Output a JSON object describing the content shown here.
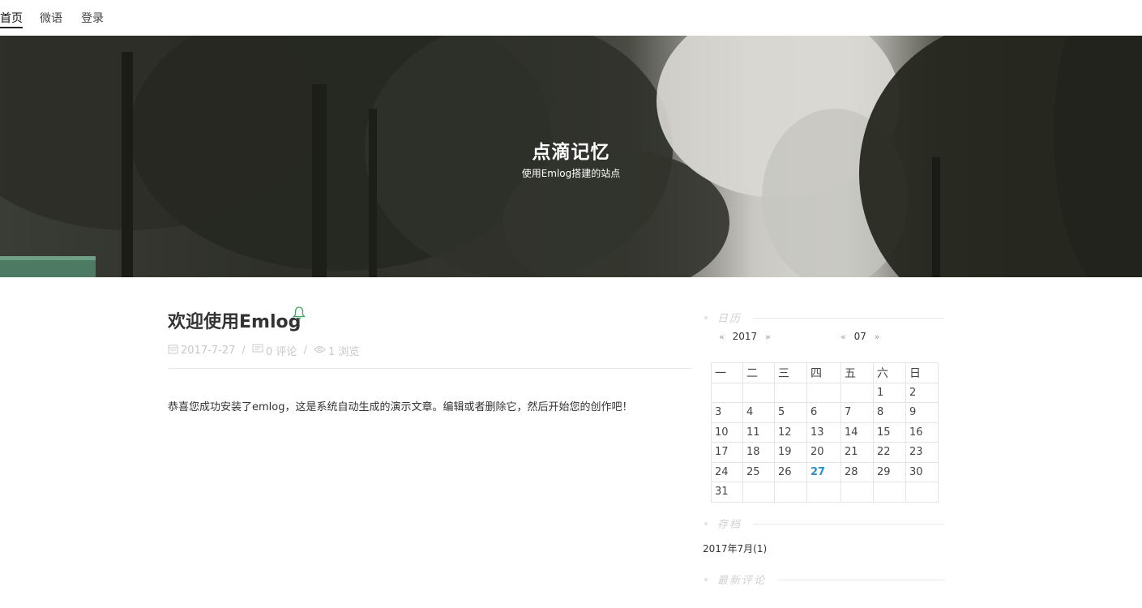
{
  "nav": {
    "home": "首页",
    "micro": "微语",
    "login": "登录"
  },
  "site": {
    "title": "点滴记忆",
    "subtitle": "使用Emlog搭建的站点"
  },
  "post": {
    "title": "欢迎使用Emlog",
    "date": "2017-7-27",
    "comments": "0 评论",
    "views": "1 浏览",
    "separator": "/",
    "body": "恭喜您成功安装了emlog，这是系统自动生成的演示文章。编辑或者删除它，然后开始您的创作吧！"
  },
  "sidebar": {
    "calendar_title": "日历",
    "year": "2017",
    "month": "07",
    "prev": "«",
    "next": "»",
    "weekdays": [
      "一",
      "二",
      "三",
      "四",
      "五",
      "六",
      "日"
    ],
    "weeks": [
      [
        "",
        "",
        "",
        "",
        "",
        "1",
        "2"
      ],
      [
        "3",
        "4",
        "5",
        "6",
        "7",
        "8",
        "9"
      ],
      [
        "10",
        "11",
        "12",
        "13",
        "14",
        "15",
        "16"
      ],
      [
        "17",
        "18",
        "19",
        "20",
        "21",
        "22",
        "23"
      ],
      [
        "24",
        "25",
        "26",
        "27",
        "28",
        "29",
        "30"
      ],
      [
        "31",
        "",
        "",
        "",
        "",
        "",
        ""
      ]
    ],
    "today": "27",
    "archive_title": "存档",
    "archive_item": "2017年7月(1)",
    "latest_comments_title": "最新评论"
  },
  "colors": {
    "accent": "#2a8fd0",
    "bell": "#3aa55a"
  }
}
